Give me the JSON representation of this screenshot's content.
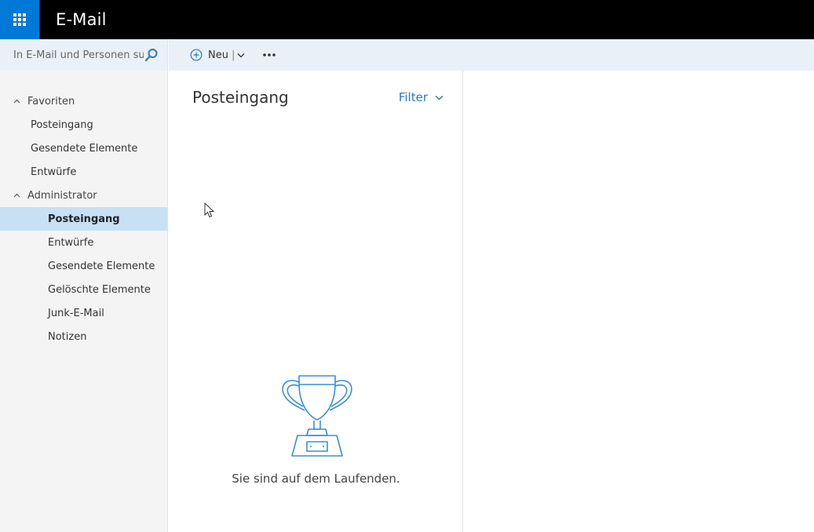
{
  "app": {
    "title": "E-Mail"
  },
  "search": {
    "placeholder": "In E-Mail und Personen su..."
  },
  "toolbar": {
    "new_label": "Neu",
    "separator": "|"
  },
  "folders": {
    "favorites": {
      "label": "Favoriten",
      "items": [
        "Posteingang",
        "Gesendete Elemente",
        "Entwürfe"
      ]
    },
    "account": {
      "label": "Administrator",
      "items": [
        "Posteingang",
        "Entwürfe",
        "Gesendete Elemente",
        "Gelöschte Elemente",
        "Junk-E-Mail",
        "Notizen"
      ],
      "selected": "Posteingang"
    }
  },
  "message_list": {
    "title": "Posteingang",
    "filter_label": "Filter",
    "empty_state": "Sie sind auf dem Laufenden."
  },
  "colors": {
    "accent": "#0078d7",
    "link": "#2b78c2",
    "selection": "#c7e0f4",
    "toolbar_bg": "#eaf0f7"
  },
  "icons": [
    "waffle-icon",
    "search-icon",
    "add-circle-icon",
    "chevron-down-icon",
    "more-icon",
    "chevron-up-icon",
    "trophy-icon"
  ]
}
